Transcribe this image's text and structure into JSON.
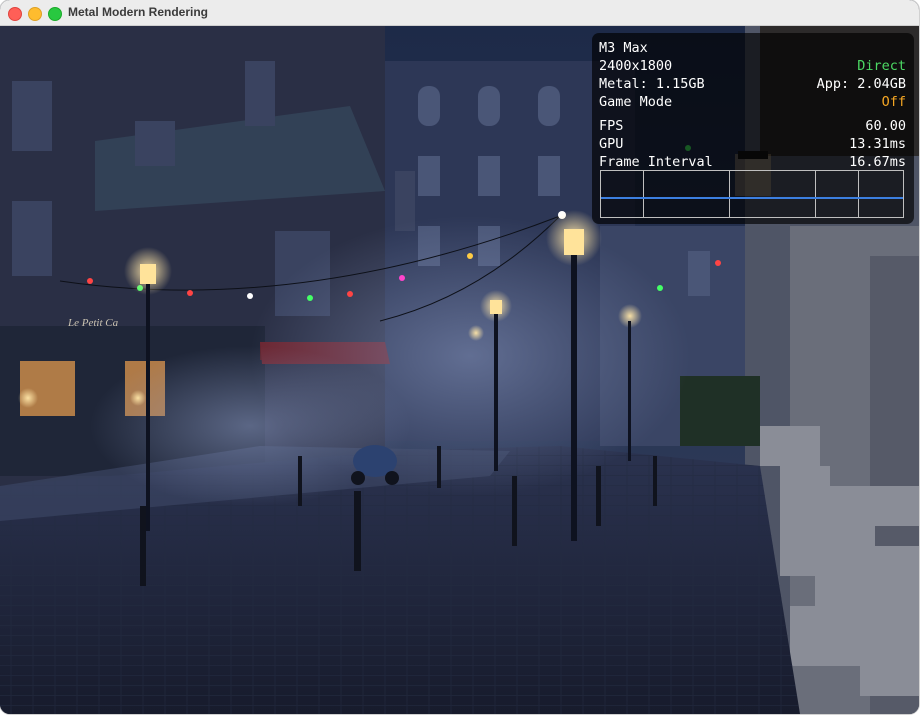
{
  "window": {
    "title": "Metal Modern Rendering"
  },
  "hud": {
    "device": "M3 Max",
    "resolution": "2400x1800",
    "presentation_mode": "Direct",
    "metal_memory": "Metal: 1.15GB",
    "app_memory": "App: 2.04GB",
    "game_mode_label": "Game Mode",
    "game_mode_value": "Off",
    "fps_label": "FPS",
    "fps_value": "60.00",
    "gpu_label": "GPU",
    "gpu_value": "13.31ms",
    "frame_interval_label": "Frame Interval",
    "frame_interval_value": "16.67ms",
    "colors": {
      "positive": "#4cd964",
      "warning": "#f5a623",
      "graph_line": "#3c7fe0"
    }
  },
  "scene": {
    "sign_text": "Le Petit Ca"
  }
}
